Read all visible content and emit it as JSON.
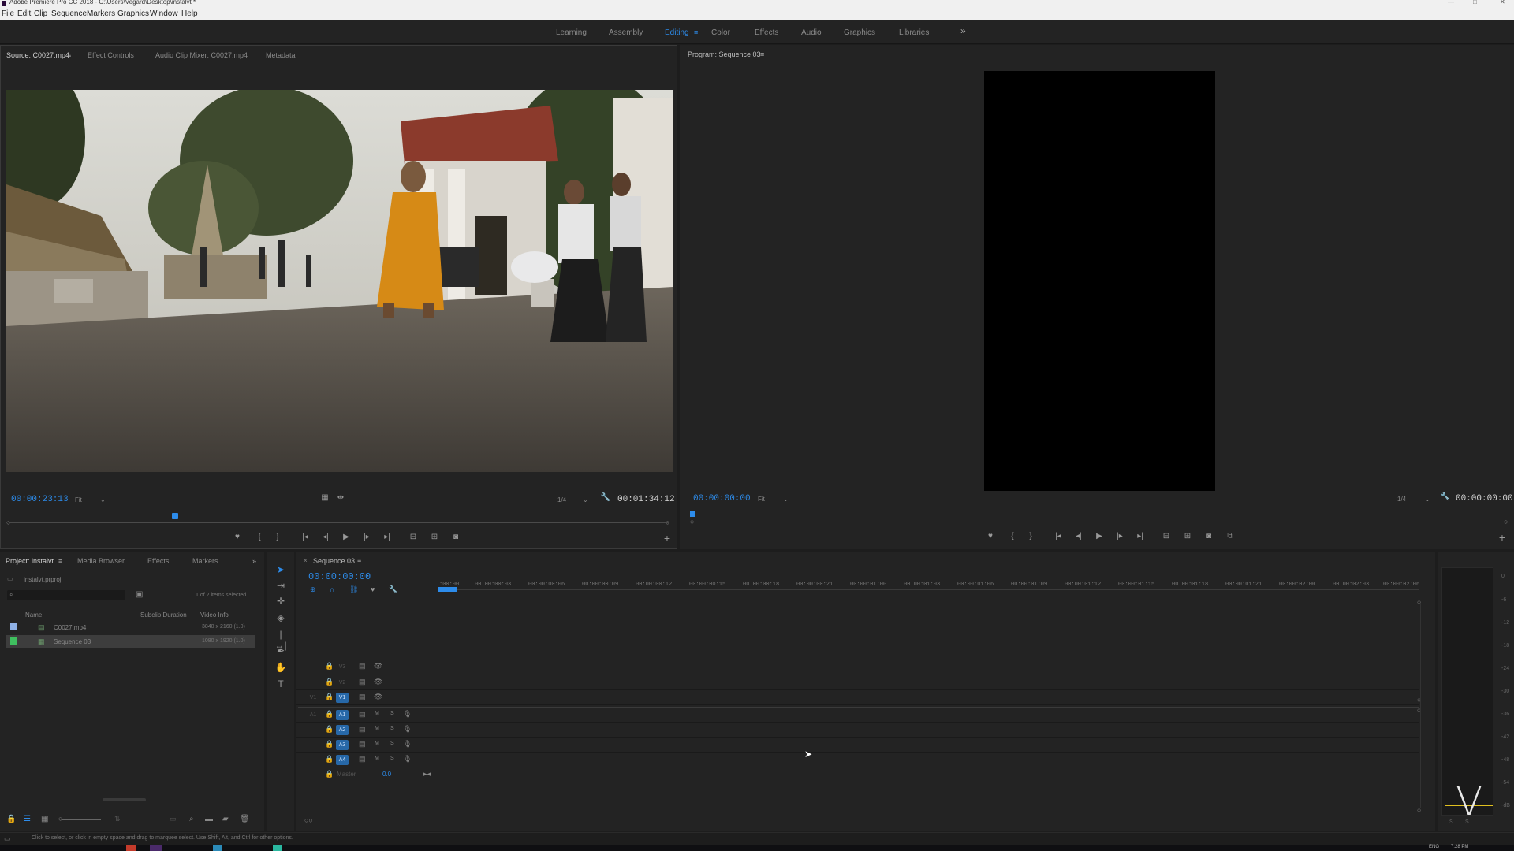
{
  "window": {
    "title": "Adobe Premiere Pro CC 2018 - C:\\Users\\Vegard\\Desktop\\instalvt *"
  },
  "menu": [
    "File",
    "Edit",
    "Clip",
    "Sequence",
    "Markers",
    "Graphics",
    "Window",
    "Help"
  ],
  "workspaces": {
    "items": [
      "Learning",
      "Assembly",
      "Editing",
      "Color",
      "Effects",
      "Audio",
      "Graphics",
      "Libraries"
    ],
    "active": "Editing",
    "more": "»"
  },
  "source_panel": {
    "tabs": [
      "Source: C0027.mp4",
      "Effect Controls",
      "Audio Clip Mixer: C0027.mp4",
      "Metadata"
    ],
    "timecode_current": "00:00:23:13",
    "fit": "Fit",
    "resolution": "1/4",
    "duration": "00:01:34:12",
    "playhead_fraction": 0.25
  },
  "program_panel": {
    "tab": "Program: Sequence 03",
    "timecode_current": "00:00:00:00",
    "fit": "Fit",
    "resolution": "1/4",
    "duration": "00:00:00:00"
  },
  "project_panel": {
    "tabs": [
      "Project: instalvt",
      "Media Browser",
      "Effects",
      "Markers"
    ],
    "project_file": "instalvt.prproj",
    "selection_info": "1 of 2 items selected",
    "columns": [
      "Name",
      "Subclip Duration",
      "Video Info"
    ],
    "items": [
      {
        "name": "C0027.mp4",
        "video_info": "3840 x 2160 (1.0)",
        "color": "#8fb1e6"
      },
      {
        "name": "Sequence 03",
        "video_info": "1080 x 1920 (1.0)",
        "color": "#3fbf5f"
      }
    ]
  },
  "timeline": {
    "tab": "Sequence 03",
    "timecode": "00:00:00:00",
    "ruler": [
      ":00:00",
      "00:00:00:03",
      "00:00:00:06",
      "00:00:00:09",
      "00:00:00:12",
      "00:00:00:15",
      "00:00:00:18",
      "00:00:00:21",
      "00:00:01:00",
      "00:00:01:03",
      "00:00:01:06",
      "00:00:01:09",
      "00:00:01:12",
      "00:00:01:15",
      "00:00:01:18",
      "00:00:01:21",
      "00:00:02:00",
      "00:00:02:03",
      "00:00:02:06"
    ],
    "video_tracks": [
      "V3",
      "V2",
      "V1"
    ],
    "audio_tracks": [
      "A1",
      "A2",
      "A3",
      "A4"
    ],
    "master_label": "Master",
    "master_value": "0.0",
    "track_m": "M",
    "track_s": "S",
    "source_v": "V1",
    "source_a": "A1"
  },
  "audio_meter": {
    "labels": [
      "0",
      "-6",
      "-12",
      "-18",
      "-24",
      "-30",
      "-36",
      "-42",
      "-48",
      "-54",
      "-dB"
    ],
    "s_labels": [
      "S",
      "S"
    ]
  },
  "status_bar": {
    "message": "Click to select, or click in empty space and drag to marquee select. Use Shift, Alt, and Ctrl for other options."
  },
  "taskbar": {
    "lang": "ENG",
    "time": "7:28 PM"
  },
  "watermark": "V",
  "colors": {
    "accent": "#2d8ceb",
    "track_active": "#2768a8",
    "panel_bg": "#232323"
  }
}
